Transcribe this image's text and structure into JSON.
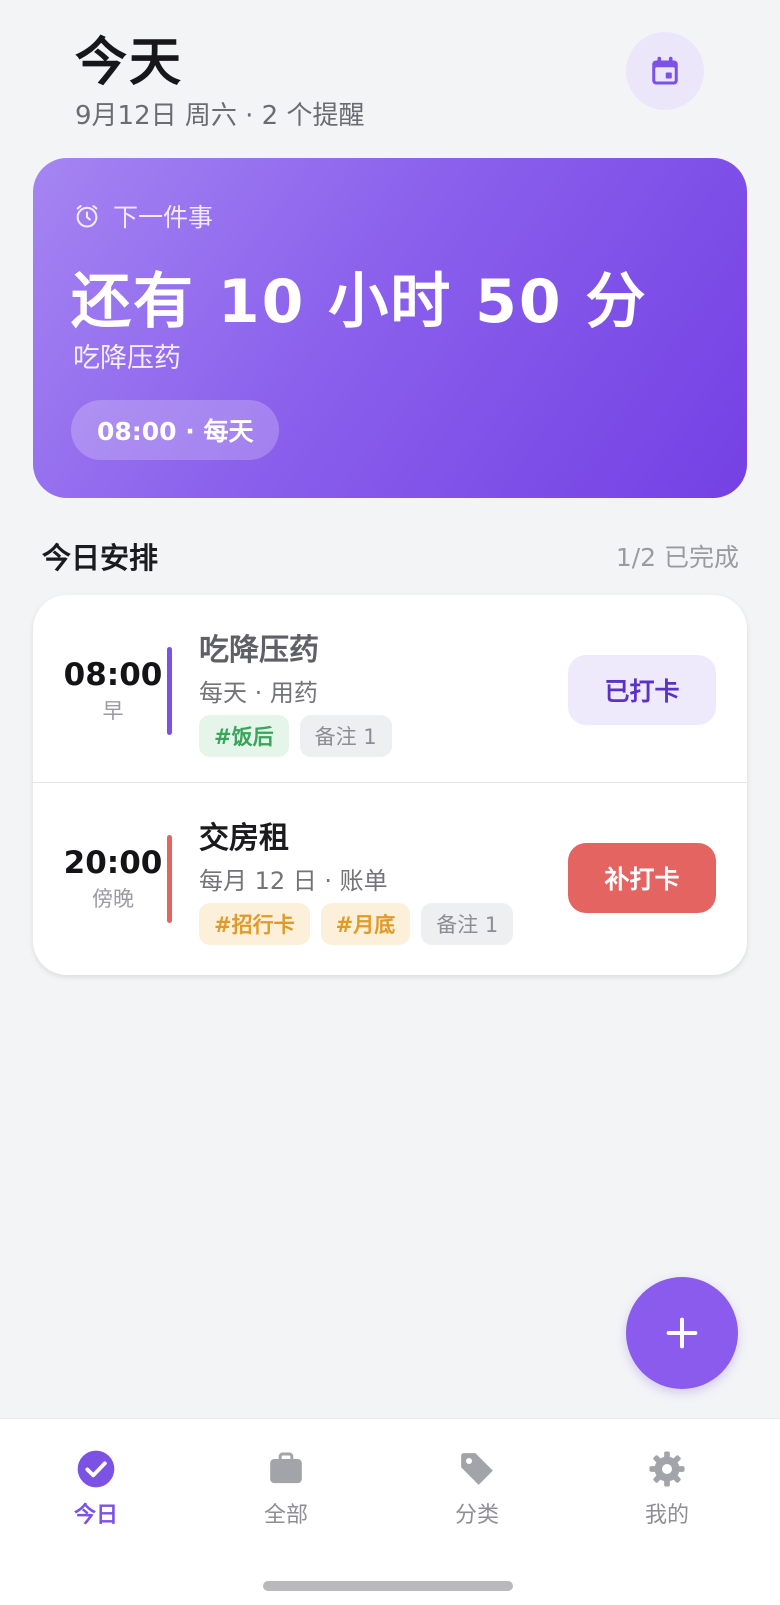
{
  "header": {
    "title": "今天",
    "subtitle": "9月12日 周六 · 2 个提醒",
    "calendar_icon": "calendar-icon"
  },
  "next_card": {
    "label": "下一件事",
    "icon": "alarm-clock-icon",
    "countdown": "还有 10 小时 50 分",
    "task": "吃降压药",
    "pill": "08:00 · 每天"
  },
  "schedule": {
    "title": "今日安排",
    "progress": "1/2 已完成",
    "items": [
      {
        "time": "08:00",
        "period": "早",
        "title": "吃降压药",
        "meta": "每天 · 用药",
        "bar_color": "#7b52e4",
        "title_color": "#5f5f66",
        "tags": [
          {
            "text": "#饭后",
            "style": "green"
          },
          {
            "text": "备注 1",
            "style": "gray"
          }
        ],
        "action": "已打卡"
      },
      {
        "time": "20:00",
        "period": "傍晚",
        "title": "交房租",
        "meta": "每月 12 日 · 账单",
        "bar_color": "#e36460",
        "title_color": "#1b1b1f",
        "tags": [
          {
            "text": "#招行卡",
            "style": "orange"
          },
          {
            "text": "#月底",
            "style": "orange"
          },
          {
            "text": "备注 1",
            "style": "gray"
          }
        ],
        "action": "补打卡"
      }
    ]
  },
  "fab": {
    "icon": "plus-icon"
  },
  "tabbar": {
    "tabs": [
      {
        "label": "今日",
        "icon": "check-circle-icon",
        "active": true
      },
      {
        "label": "全部",
        "icon": "briefcase-icon",
        "active": false
      },
      {
        "label": "分类",
        "icon": "tag-icon",
        "active": false
      },
      {
        "label": "我的",
        "icon": "gear-icon",
        "active": false
      }
    ]
  },
  "colors": {
    "accent": "#7b52e4",
    "danger": "#e36460",
    "background": "#f3f4f6"
  }
}
